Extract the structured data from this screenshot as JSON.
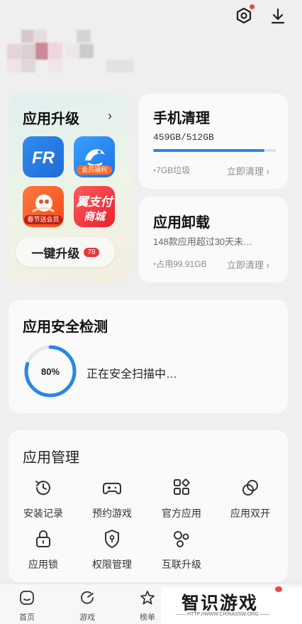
{
  "header": {
    "settings_icon": "settings-hex-icon",
    "download_icon": "download-icon",
    "notification_dot_color": "#f04a3e"
  },
  "upgrade": {
    "title": "应用升级",
    "apps": [
      {
        "name": "FR",
        "badge_text": ""
      },
      {
        "name": "dolphin",
        "badge_text": "会员福利"
      },
      {
        "name": "uc",
        "badge_text": "春节送会员"
      },
      {
        "name": "yipay",
        "text_top": "翼支付",
        "text_bottom": "商城"
      }
    ],
    "button_label": "一键升级",
    "button_badge": "78"
  },
  "clean": {
    "title": "手机清理",
    "storage": "459GB/512GB",
    "progress": 0.9,
    "junk": "7GB垃圾",
    "action": "立即清理 ›"
  },
  "uninstall": {
    "title": "应用卸载",
    "subtitle": "148款应用超过30天未…",
    "usage": "占用99.91GB",
    "action": "立即清理 ›"
  },
  "security": {
    "title": "应用安全检测",
    "percent_text": "80%",
    "percent": 0.8,
    "status": "正在安全扫描中…"
  },
  "management": {
    "title": "应用管理",
    "items": [
      {
        "label": "安装记录",
        "icon": "history-icon"
      },
      {
        "label": "预约游戏",
        "icon": "gamepad-icon"
      },
      {
        "label": "官方应用",
        "icon": "apps-grid-icon"
      },
      {
        "label": "应用双开",
        "icon": "dual-circle-icon"
      },
      {
        "label": "应用锁",
        "icon": "lock-icon"
      },
      {
        "label": "权限管理",
        "icon": "shield-permission-icon"
      },
      {
        "label": "互联升级",
        "icon": "connect-icon"
      }
    ]
  },
  "tabs": [
    {
      "label": "首页",
      "icon": "home-icon"
    },
    {
      "label": "游戏",
      "icon": "game-icon"
    },
    {
      "label": "榜单",
      "icon": "star-icon"
    }
  ],
  "watermark": {
    "text": "智识游戏",
    "sub": "—— HTTP://WWW.CHINASSW.ORG ——"
  },
  "colors": {
    "accent": "#2a86e8",
    "badge": "#e4393c"
  }
}
